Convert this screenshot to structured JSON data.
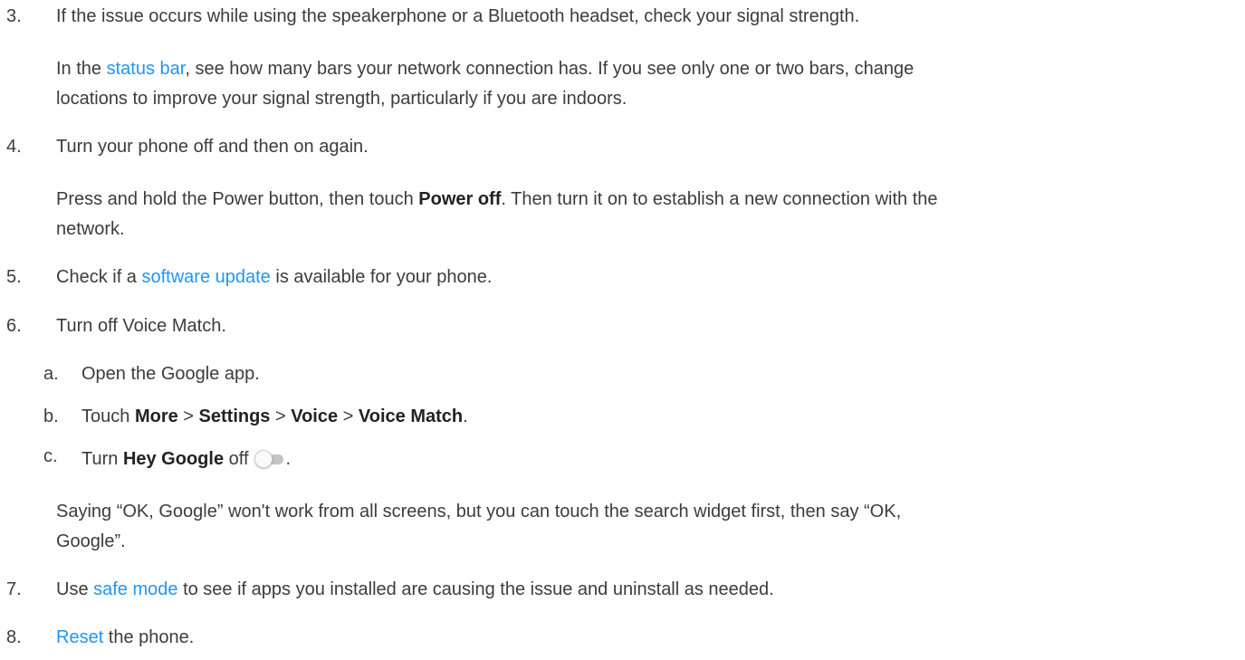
{
  "steps": {
    "s3": {
      "num": "3.",
      "text": "If the issue occurs while using the speakerphone or a Bluetooth headset, check your signal strength.",
      "para_l1_pre": "In the ",
      "para_l1_link": "status bar",
      "para_l1_post": ", see how many bars your network connection has. If you see only one or two bars, change",
      "para_l2": "locations to improve your signal strength, particularly if you are indoors."
    },
    "s4": {
      "num": "4.",
      "text": "Turn your phone off and then on again.",
      "para_l1_pre": "Press and hold the Power button, then touch ",
      "para_l1_bold": "Power off",
      "para_l1_post": ". Then turn it on to establish a new connection with the",
      "para_l2": "network."
    },
    "s5": {
      "num": "5.",
      "pre": "Check if a ",
      "link": "software update",
      "post": " is available for your phone."
    },
    "s6": {
      "num": "6.",
      "text": "Turn off Voice Match.",
      "a": {
        "letter": "a.",
        "text": "Open the Google app."
      },
      "b": {
        "letter": "b.",
        "pre": "Touch ",
        "more": "More",
        "sep1": " > ",
        "settings": "Settings",
        "sep2": " > ",
        "voice": "Voice",
        "sep3": " > ",
        "voice_match": "Voice Match",
        "end": "."
      },
      "c": {
        "letter": "c.",
        "pre": "Turn ",
        "bold": "Hey Google",
        "post": " off",
        "end": ".",
        "toggle_state": "off"
      },
      "note_l1": "Saying “OK, Google” won't work from all screens, but you can touch the search widget first, then say “OK,",
      "note_l2": "Google”."
    },
    "s7": {
      "num": "7.",
      "pre": "Use ",
      "link": "safe mode",
      "post": " to see if apps you installed are causing the issue and uninstall as needed."
    },
    "s8": {
      "num": "8.",
      "link": "Reset",
      "post": " the phone."
    }
  },
  "colors": {
    "text": "#3c3c3c",
    "link": "#2196f3",
    "bold": "#222222"
  },
  "icons": {
    "toggle": "toggle-switch-off-icon"
  }
}
